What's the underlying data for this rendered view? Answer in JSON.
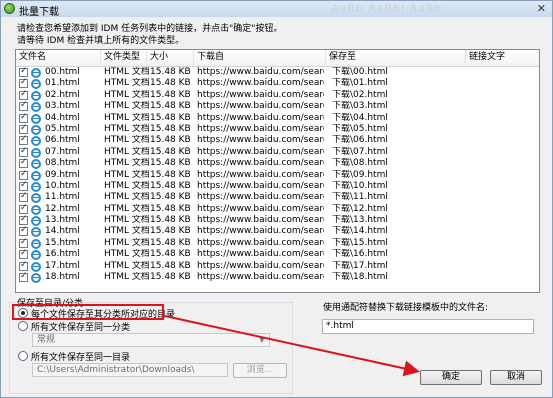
{
  "window": {
    "title": "批量下载",
    "ghost_text": "AaBb AaBbl AaBb",
    "close_label": "✕"
  },
  "instructions": {
    "line1": "请检查您希望添加到 IDM 任务列表中的链接，并点击\"确定\"按钮。",
    "line2": "请等待 IDM 检查并填上所有的文件类型。"
  },
  "table": {
    "columns": [
      "文件名",
      "文件类型",
      "大小",
      "下载自",
      "保存至",
      "链接文字"
    ],
    "rows": [
      {
        "name": "00.html",
        "type": "HTML 文档",
        "size": "15.48 KB",
        "url": "https://www.baidu.com/search/erro...",
        "save": "下载\\00.html"
      },
      {
        "name": "01.html",
        "type": "HTML 文档",
        "size": "15.48 KB",
        "url": "https://www.baidu.com/search/erro...",
        "save": "下载\\01.html"
      },
      {
        "name": "02.html",
        "type": "HTML 文档",
        "size": "15.48 KB",
        "url": "https://www.baidu.com/search/erro...",
        "save": "下载\\02.html"
      },
      {
        "name": "03.html",
        "type": "HTML 文档",
        "size": "15.48 KB",
        "url": "https://www.baidu.com/search/erro...",
        "save": "下载\\03.html"
      },
      {
        "name": "04.html",
        "type": "HTML 文档",
        "size": "15.48 KB",
        "url": "https://www.baidu.com/search/erro...",
        "save": "下载\\04.html"
      },
      {
        "name": "05.html",
        "type": "HTML 文档",
        "size": "15.48 KB",
        "url": "https://www.baidu.com/search/erro...",
        "save": "下载\\05.html"
      },
      {
        "name": "06.html",
        "type": "HTML 文档",
        "size": "15.48 KB",
        "url": "https://www.baidu.com/search/erro...",
        "save": "下载\\06.html"
      },
      {
        "name": "07.html",
        "type": "HTML 文档",
        "size": "15.48 KB",
        "url": "https://www.baidu.com/search/erro...",
        "save": "下载\\07.html"
      },
      {
        "name": "08.html",
        "type": "HTML 文档",
        "size": "15.48 KB",
        "url": "https://www.baidu.com/search/erro...",
        "save": "下载\\08.html"
      },
      {
        "name": "09.html",
        "type": "HTML 文档",
        "size": "15.48 KB",
        "url": "https://www.baidu.com/search/erro...",
        "save": "下载\\09.html"
      },
      {
        "name": "10.html",
        "type": "HTML 文档",
        "size": "15.48 KB",
        "url": "https://www.baidu.com/search/erro...",
        "save": "下载\\10.html"
      },
      {
        "name": "11.html",
        "type": "HTML 文档",
        "size": "15.48 KB",
        "url": "https://www.baidu.com/search/erro...",
        "save": "下载\\11.html"
      },
      {
        "name": "12.html",
        "type": "HTML 文档",
        "size": "15.48 KB",
        "url": "https://www.baidu.com/search/erro...",
        "save": "下载\\12.html"
      },
      {
        "name": "13.html",
        "type": "HTML 文档",
        "size": "15.48 KB",
        "url": "https://www.baidu.com/search/erro...",
        "save": "下载\\13.html"
      },
      {
        "name": "14.html",
        "type": "HTML 文档",
        "size": "15.48 KB",
        "url": "https://www.baidu.com/search/erro...",
        "save": "下载\\14.html"
      },
      {
        "name": "15.html",
        "type": "HTML 文档",
        "size": "15.48 KB",
        "url": "https://www.baidu.com/search/erro...",
        "save": "下载\\15.html"
      },
      {
        "name": "16.html",
        "type": "HTML 文档",
        "size": "15.48 KB",
        "url": "https://www.baidu.com/search/erro...",
        "save": "下载\\16.html"
      },
      {
        "name": "17.html",
        "type": "HTML 文档",
        "size": "15.48 KB",
        "url": "https://www.baidu.com/search/erro...",
        "save": "下载\\17.html"
      },
      {
        "name": "18.html",
        "type": "HTML 文档",
        "size": "15.48 KB",
        "url": "https://www.baidu.com/search/erro...",
        "save": "下载\\18.html"
      }
    ]
  },
  "save_group": {
    "title": "保存至目录/分类",
    "option1": "每个文件保存至其分类所对应的目录",
    "option2": "所有文件保存至同一分类",
    "category_value": "常规",
    "option3": "所有文件保存至同一目录",
    "path_value": "C:\\Users\\Administrator\\Downloads\\",
    "browse_label": "浏览..."
  },
  "template": {
    "label": "使用通配符替换下载链接模板中的文件名:",
    "value": "*.html"
  },
  "buttons": {
    "ok": "确定",
    "cancel": "取消"
  },
  "colors": {
    "highlight": "#d9141d",
    "title_bar": "#c9d9ec"
  }
}
